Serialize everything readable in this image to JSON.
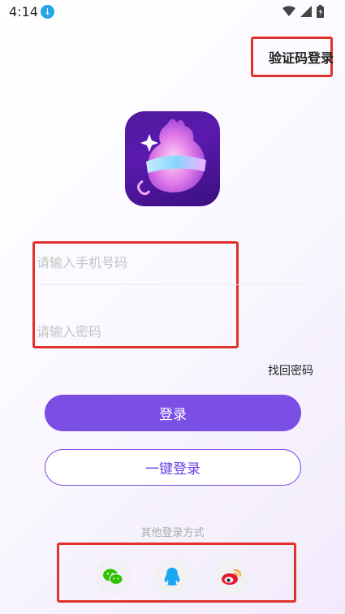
{
  "status_bar": {
    "time": "4:14",
    "icons": [
      "download-icon",
      "wifi-icon",
      "signal-icon",
      "battery-icon"
    ]
  },
  "header": {
    "verification_login": "验证码登录"
  },
  "app": {
    "logo_icon": "app-logo-icon"
  },
  "form": {
    "phone_placeholder": "请输入手机号码",
    "phone_value": "",
    "password_placeholder": "请输入密码",
    "password_value": "",
    "forgot_password": "找回密码"
  },
  "actions": {
    "login": "登录",
    "one_click_login": "一键登录"
  },
  "social": {
    "label": "其他登录方式",
    "providers": [
      {
        "name": "wechat-icon",
        "color": "#2dc100"
      },
      {
        "name": "qq-icon",
        "color": "#1aa6f0"
      },
      {
        "name": "weibo-icon",
        "color": "#e6162d"
      }
    ]
  },
  "colors": {
    "accent": "#7b4ee6",
    "highlight_frame": "#e0312b"
  }
}
